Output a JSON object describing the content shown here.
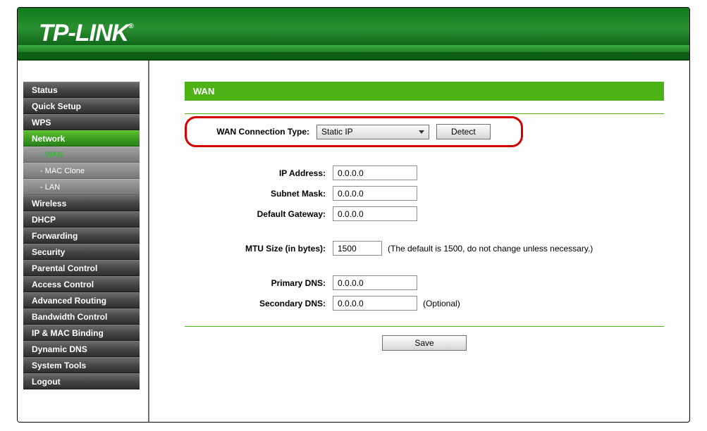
{
  "brand": "TP-LINK",
  "trademark": "®",
  "sidebar": {
    "items": [
      {
        "label": "Status",
        "type": "item"
      },
      {
        "label": "Quick Setup",
        "type": "item"
      },
      {
        "label": "WPS",
        "type": "item"
      },
      {
        "label": "Network",
        "type": "item",
        "active": true
      },
      {
        "label": "- WAN",
        "type": "sub",
        "active": true
      },
      {
        "label": "- MAC Clone",
        "type": "sub"
      },
      {
        "label": "- LAN",
        "type": "sub"
      },
      {
        "label": "Wireless",
        "type": "item"
      },
      {
        "label": "DHCP",
        "type": "item"
      },
      {
        "label": "Forwarding",
        "type": "item"
      },
      {
        "label": "Security",
        "type": "item"
      },
      {
        "label": "Parental Control",
        "type": "item"
      },
      {
        "label": "Access Control",
        "type": "item"
      },
      {
        "label": "Advanced Routing",
        "type": "item"
      },
      {
        "label": "Bandwidth Control",
        "type": "item"
      },
      {
        "label": "IP & MAC Binding",
        "type": "item"
      },
      {
        "label": "Dynamic DNS",
        "type": "item"
      },
      {
        "label": "System Tools",
        "type": "item"
      },
      {
        "label": "Logout",
        "type": "item"
      }
    ]
  },
  "page": {
    "title": "WAN",
    "connection_type_label": "WAN Connection Type:",
    "connection_type_value": "Static IP",
    "detect_label": "Detect",
    "fields": {
      "ip_label": "IP Address:",
      "ip_value": "0.0.0.0",
      "subnet_label": "Subnet Mask:",
      "subnet_value": "0.0.0.0",
      "gateway_label": "Default Gateway:",
      "gateway_value": "0.0.0.0",
      "mtu_label": "MTU Size (in bytes):",
      "mtu_value": "1500",
      "mtu_hint": "(The default is 1500, do not change unless necessary.)",
      "pdns_label": "Primary DNS:",
      "pdns_value": "0.0.0.0",
      "sdns_label": "Secondary DNS:",
      "sdns_value": "0.0.0.0",
      "sdns_hint": "(Optional)"
    },
    "save_label": "Save"
  }
}
